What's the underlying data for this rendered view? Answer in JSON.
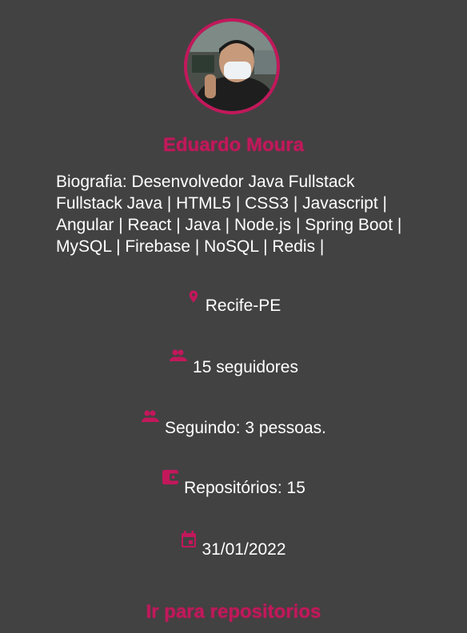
{
  "profile": {
    "name": "Eduardo Moura",
    "bio": "Biografia: Desenvolvedor Java Fullstack Fullstack Java | HTML5 | CSS3 | Javascript | Angular | React | Java | Node.js | Spring Boot | MySQL | Firebase | NoSQL | Redis |",
    "location": "Recife-PE",
    "followers": "15 seguidores",
    "following": "Seguindo: 3 pessoas.",
    "repositories": "Repositórios: 15",
    "created_at": "31/01/2022",
    "repos_link": "Ir para repositorios"
  },
  "icons": {
    "location": "location-pin-icon",
    "followers": "people-icon",
    "following": "people-icon",
    "repositories": "wallet-icon",
    "created_at": "calendar-icon"
  },
  "colors": {
    "background": "#424242",
    "accent": "#c2185b",
    "text": "#ffffff"
  }
}
